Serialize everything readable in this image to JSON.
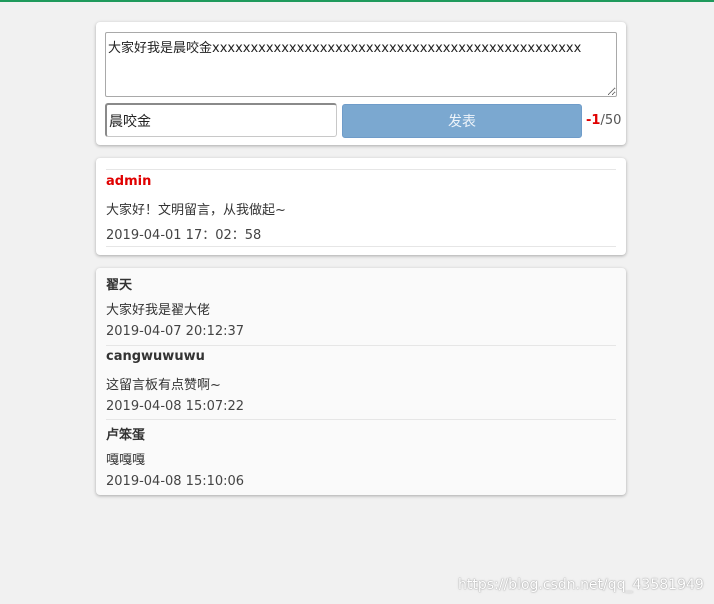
{
  "composer": {
    "message_text": "大家好我是晨咬金xxxxxxxxxxxxxxxxxxxxxxxxxxxxxxxxxxxxxxxxxxxxxxxx",
    "name_value": "晨咬金",
    "publish_label": "发表",
    "counter_remaining": "-1",
    "counter_max": "/50"
  },
  "pinned": {
    "author": "admin",
    "content": "大家好！文明留言，从我做起~",
    "time": "2019-04-01 17：02：58"
  },
  "messages": [
    {
      "author": "翟天",
      "content": "大家好我是翟大佬",
      "time": "2019-04-07 20:12:37"
    },
    {
      "author": "cangwuwuwu",
      "content": "这留言板有点赞啊~",
      "time": "2019-04-08 15:07:22"
    },
    {
      "author": "卢笨蛋",
      "content": "嘎嘎嘎",
      "time": "2019-04-08 15:10:06"
    }
  ],
  "watermark": "https://blog.csdn.net/qq_43581949",
  "colors": {
    "accent_top_border": "#1f9a5c",
    "button_bg": "#7ba8d0",
    "admin_red": "#e00000"
  }
}
